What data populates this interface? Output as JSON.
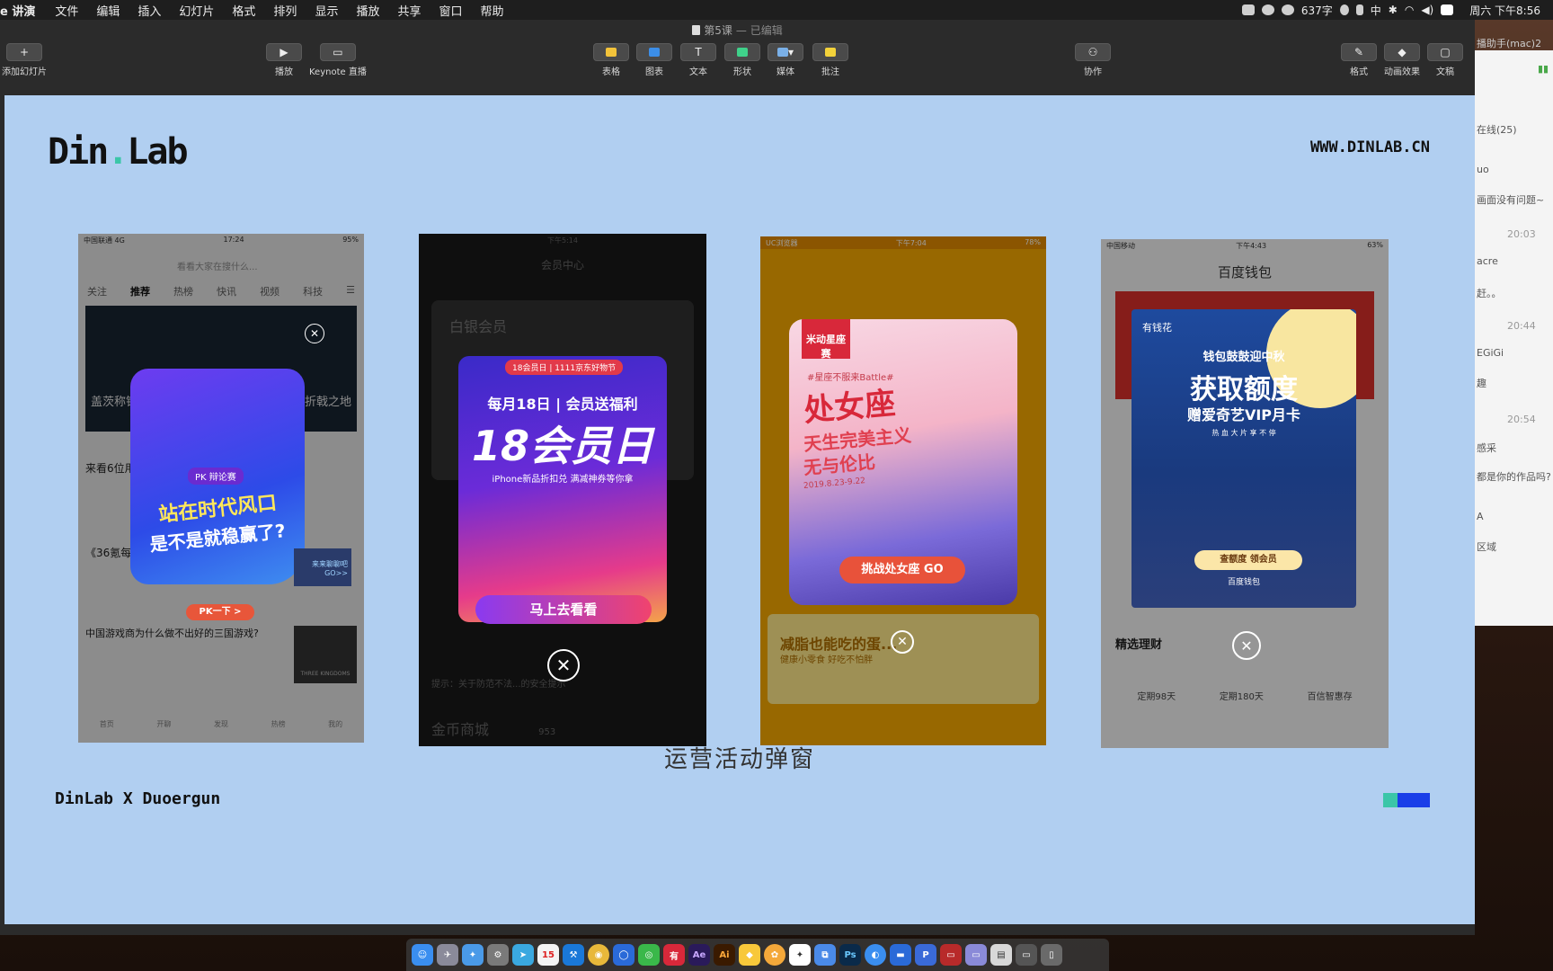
{
  "menubar": {
    "app": "e 讲演",
    "items": [
      "文件",
      "编辑",
      "插入",
      "幻灯片",
      "格式",
      "排列",
      "显示",
      "播放",
      "共享",
      "窗口",
      "帮助"
    ],
    "word_count": "637字",
    "ime": "中",
    "clock": "周六 下午8:56"
  },
  "window": {
    "title": "第5课",
    "edited": "— 已编辑"
  },
  "toolbar": {
    "add_slide": "添加幻灯片",
    "play": "播放",
    "keynote_live": "Keynote 直播",
    "table": "表格",
    "chart": "图表",
    "text": "文本",
    "shape": "形状",
    "media": "媒体",
    "comment": "批注",
    "collaborate": "协作",
    "format": "格式",
    "animate": "动画效果",
    "document": "文稿"
  },
  "slide": {
    "logo_left": "Din",
    "logo_right": "Lab",
    "website": "WWW.DINLAB.CN",
    "caption": "运营活动弹窗",
    "footer": "DinLab X Duoergun",
    "accent_colors": [
      "#3bc6a8",
      "#1a3ee8"
    ]
  },
  "phones": [
    {
      "status_time": "17:24",
      "status_left": "中国联通 4G",
      "status_right": "95%",
      "search_placeholder": "看看大家在搜什么...",
      "tabs": [
        "关注",
        "推荐",
        "热榜",
        "快讯",
        "视频",
        "科技"
      ],
      "headline": "盖茨称错失移动系统... 华为为能...",
      "headline_right": "折戟之地",
      "row1": "来看6位用...",
      "row2": "《36氪每...",
      "row3": "中国游戏商为什么做不出好的三国游戏?",
      "badge": "PK 辩论赛",
      "popup_line1": "站在时代风口",
      "popup_line2": "是不是就稳赢了?",
      "cta": "PK一下 >",
      "side_tag": "来来聊聊吧 GO>>",
      "thumb": "THREE KINGDOMS",
      "nav": [
        "首页",
        "开聊",
        "发现",
        "热榜",
        "我的"
      ]
    },
    {
      "status_time": "下午5:14",
      "header": "会员中心",
      "brand": "白银会员",
      "tag": "18会员日 | 1111京东好物节",
      "line1": "每月18日 | 会员送福利",
      "big": "18会员日",
      "line2": "iPhone新品折扣兑 满减神券等你拿",
      "cta": "马上去看看",
      "notice": "提示：关于防范不法...的安全提示",
      "mall": "金币商城",
      "mall_count": "953"
    },
    {
      "status_left": "UC浏览器",
      "status_time": "下午7:04",
      "status_right": "78%",
      "tag": "米动星座赛",
      "subtitle": "#星座不服来Battle#",
      "big": "处女座",
      "line1": "天生完美主义",
      "line2": "无与伦比",
      "date": "2019.8.23-9.22",
      "cta": "挑战处女座 GO",
      "banner": "减脂也能吃的蛋...",
      "banner_sub": "健康小零食 好吃不怕胖"
    },
    {
      "status_left": "中国移动",
      "status_time": "下午4:43",
      "status_right": "63%",
      "header": "百度钱包",
      "brand": "有钱花",
      "line1": "钱包鼓鼓迎中秋",
      "big": "获取额度",
      "line2": "赠爱奇艺VIP月卡",
      "line3": "热 血 大 片 享 不 停",
      "cta": "查额度 领会员",
      "footer_brand": "百度钱包",
      "section": "精选理财",
      "terms": [
        "定期98天",
        "定期180天",
        "百信智惠存"
      ]
    }
  ],
  "chat": {
    "title": "播助手(mac)2",
    "online": "在线(25)",
    "msgs": [
      "uo",
      "画面没有问题~",
      "20:03",
      "acre",
      "赶。。",
      "20:44",
      "EGiGi",
      "趣",
      "20:54",
      "感采",
      "都是你的作品吗?",
      "A",
      "区域"
    ]
  },
  "dock_apps": [
    "Finder",
    "Launchpad",
    "Safari",
    "Settings",
    "Telegram",
    "Calendar",
    "Xcode",
    "Chrome",
    "QQ",
    "WeChat",
    "有道",
    "Ae",
    "Ai",
    "Sketch",
    "Photos",
    "Baidu",
    "Preview",
    "Ps",
    "Browser",
    "Keynote",
    "P",
    "Stack1",
    "Stack2",
    "Stack3",
    "Stack4",
    "Trash"
  ]
}
